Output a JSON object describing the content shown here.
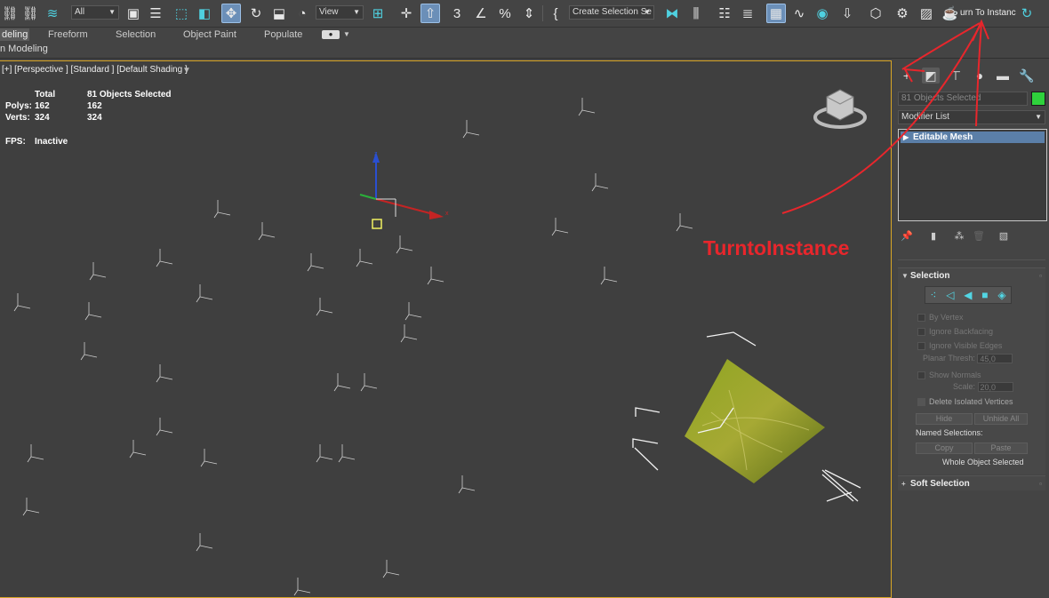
{
  "toolbar": {
    "filter_value": "All",
    "refcoord_value": "View",
    "selection_set_placeholder": "Create Selection Se",
    "turn_to_instance_label": "urn To Instanc"
  },
  "ribbon": {
    "tabs": [
      {
        "label": "deling"
      },
      {
        "label": "Freeform"
      },
      {
        "label": "Selection"
      },
      {
        "label": "Object Paint"
      },
      {
        "label": "Populate"
      }
    ],
    "sub_label": "n Modeling"
  },
  "viewport": {
    "label": "[+] [Perspective ] [Standard ] [Default Shading ]",
    "stats": {
      "total_header": "Total",
      "selected_header": "81 Objects Selected",
      "polys_label": "Polys:",
      "polys_total": "162",
      "polys_selected": "162",
      "verts_label": "Verts:",
      "verts_total": "324",
      "verts_selected": "324",
      "fps_label": "FPS:",
      "fps_value": "Inactive"
    }
  },
  "command_panel": {
    "object_name": "81 Objects Selected",
    "object_color": "#2fd23c",
    "modifier_list_label": "Modifier List",
    "stack_items": [
      {
        "label": "Editable Mesh"
      }
    ],
    "selection_rollout": {
      "title": "Selection",
      "by_vertex": "By Vertex",
      "ignore_backfacing": "Ignore Backfacing",
      "ignore_visible_edges": "Ignore Visible Edges",
      "planar_thresh_label": "Planar Thresh:",
      "planar_thresh_value": "45,0",
      "show_normals": "Show Normals",
      "scale_label": "Scale:",
      "scale_value": "20,0",
      "delete_isolated_vertices": "Delete Isolated Vertices",
      "hide_label": "Hide",
      "unhide_all_label": "Unhide All",
      "named_selections_label": "Named Selections:",
      "copy_label": "Copy",
      "paste_label": "Paste",
      "status": "Whole Object Selected"
    },
    "soft_selection_title": "Soft Selection"
  },
  "annotation": {
    "text": "TurntoInstance",
    "color": "#e8262c"
  },
  "colors": {
    "viewport_border": "#d9a626",
    "accent_cyan": "#4fd1e0",
    "selected_blue": "#5b7fa8"
  }
}
